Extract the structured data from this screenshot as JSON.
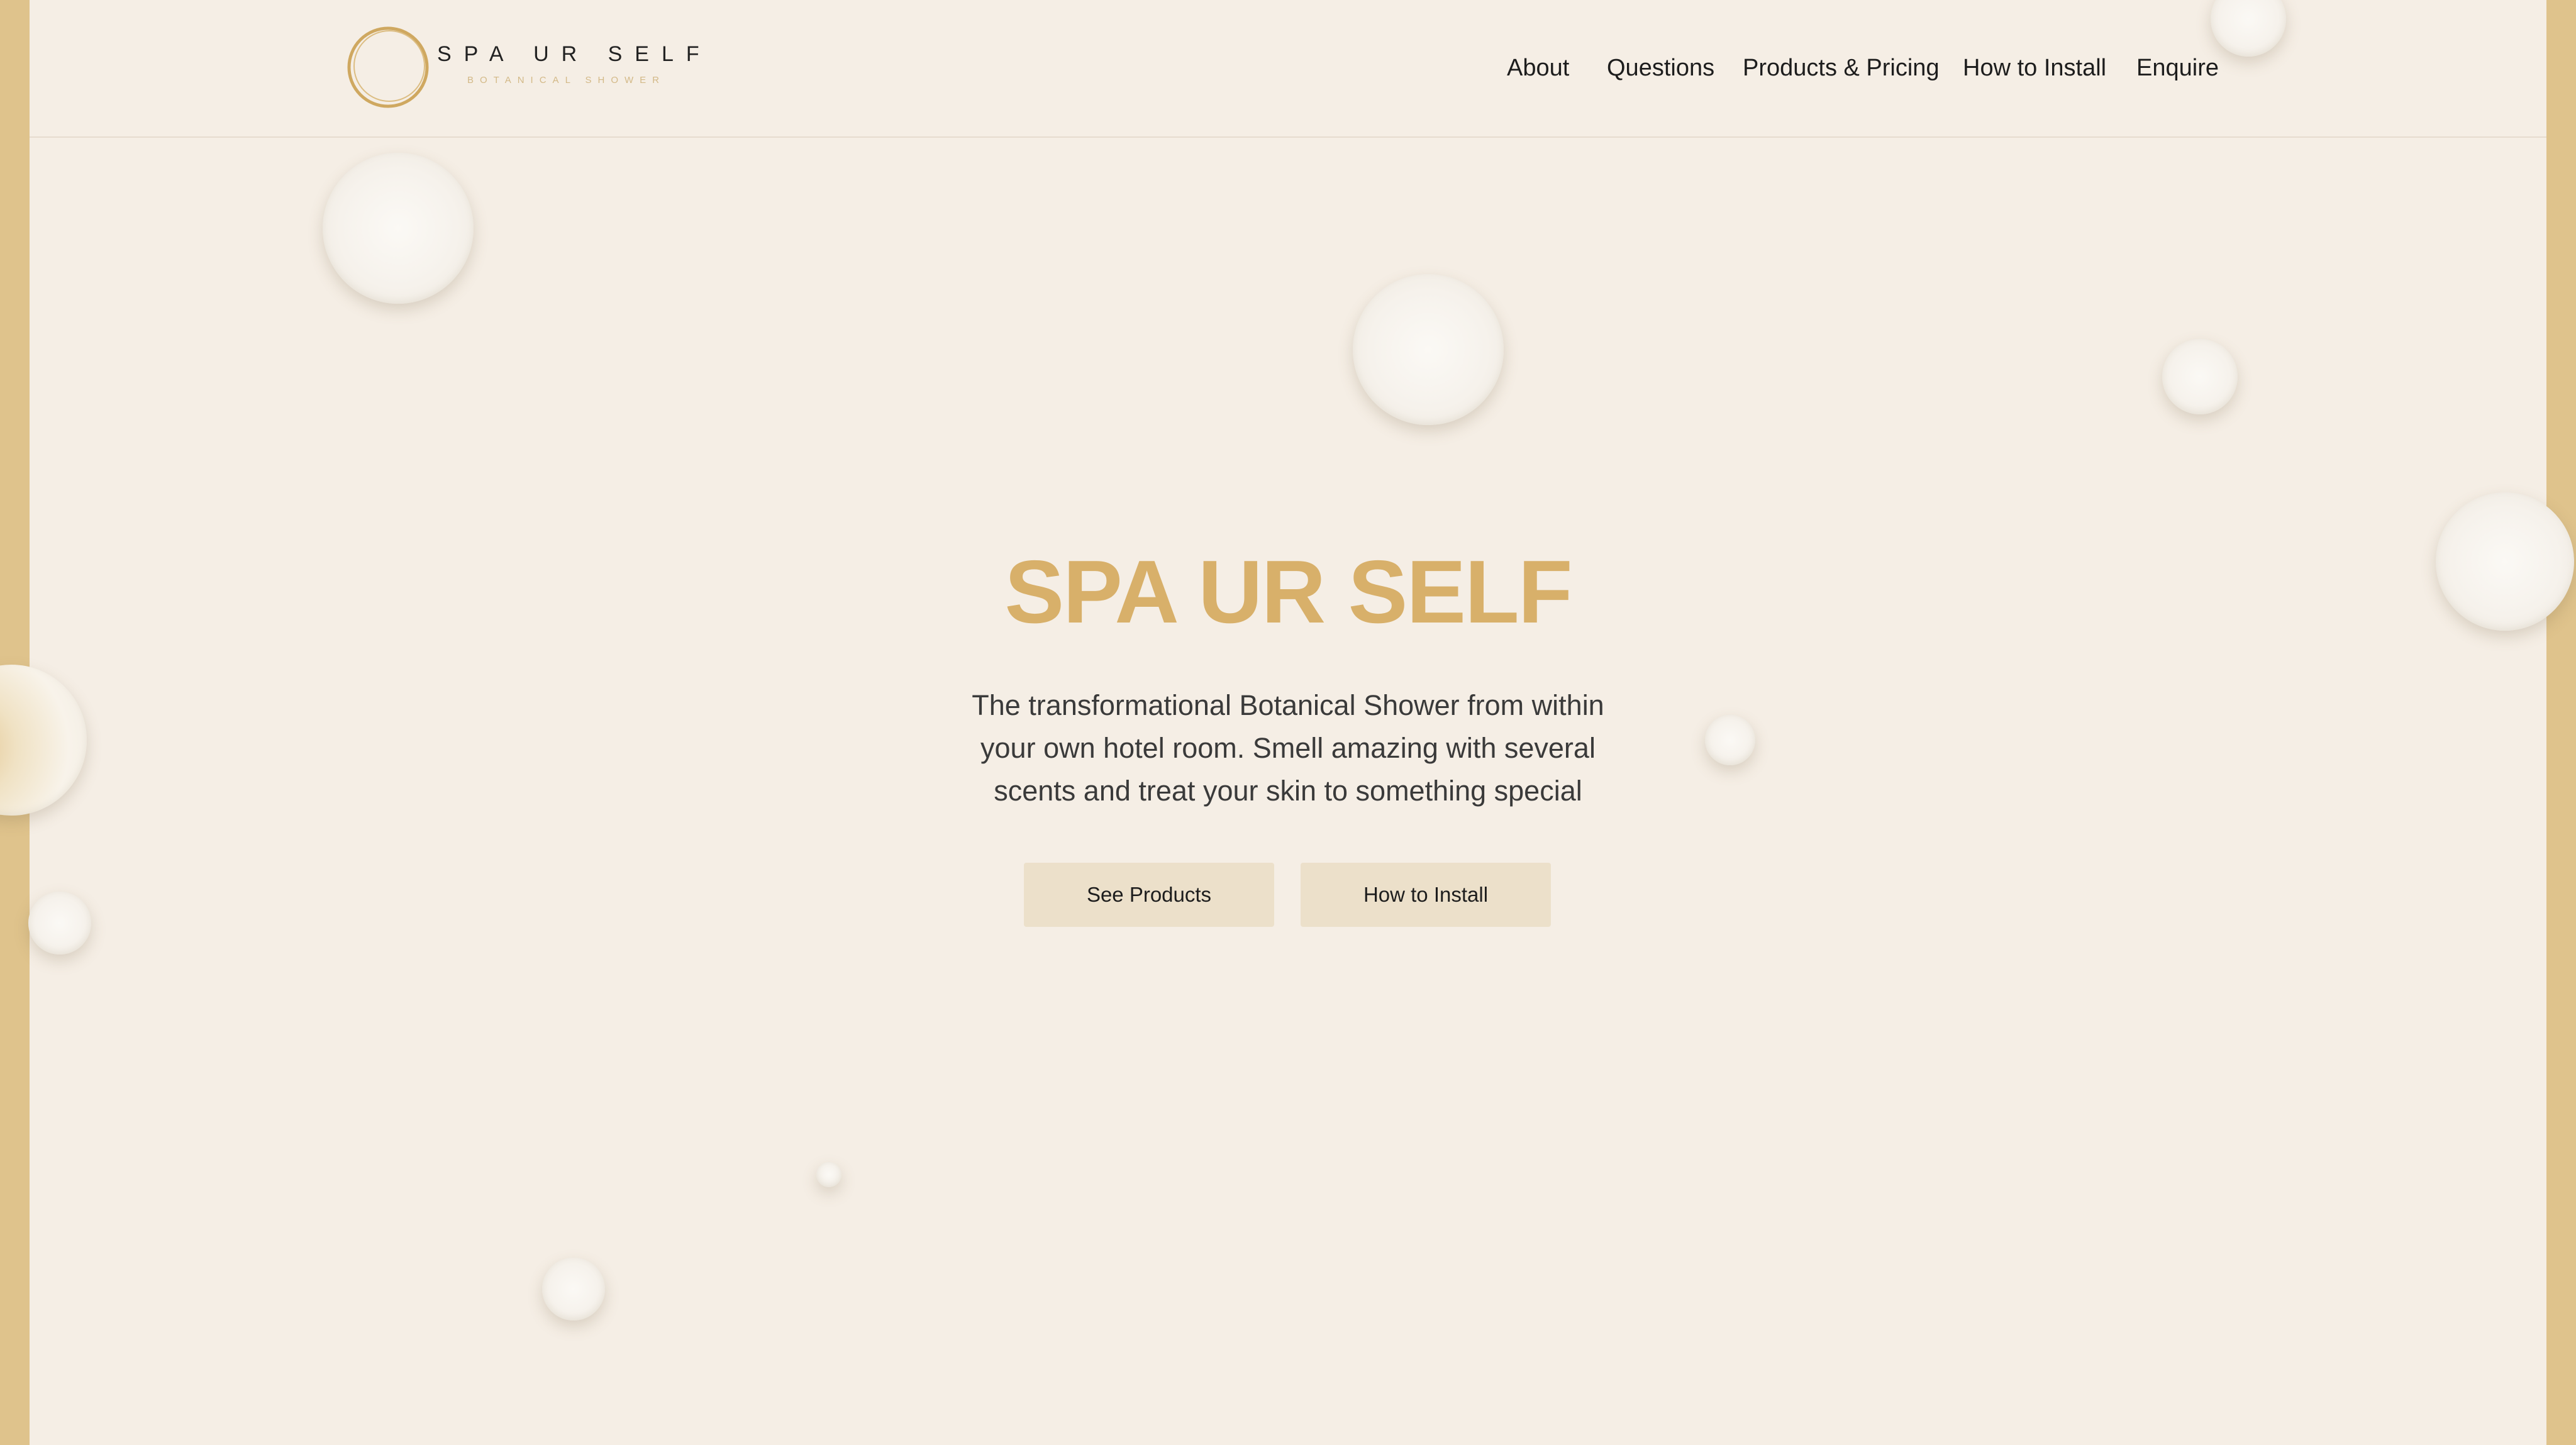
{
  "brand": {
    "name": "SPA UR SELF",
    "tagline": "BOTANICAL SHOWER"
  },
  "nav": {
    "items": [
      {
        "label": "About"
      },
      {
        "label": "Questions"
      },
      {
        "label": "Products & Pricing"
      },
      {
        "label": "How to Install"
      },
      {
        "label": "Enquire"
      }
    ]
  },
  "hero": {
    "title": "SPA UR SELF",
    "description": "The transformational Botanical Shower from within your own hotel room. Smell amazing with several scents and treat your skin to something special",
    "buttons": {
      "see_products": "See Products",
      "how_to_install": "How to Install"
    }
  },
  "colors": {
    "background": "#f5eee5",
    "accent_gold": "#d8b06a",
    "side_bar": "#dfc38c",
    "button_bg": "#ece0ca"
  }
}
